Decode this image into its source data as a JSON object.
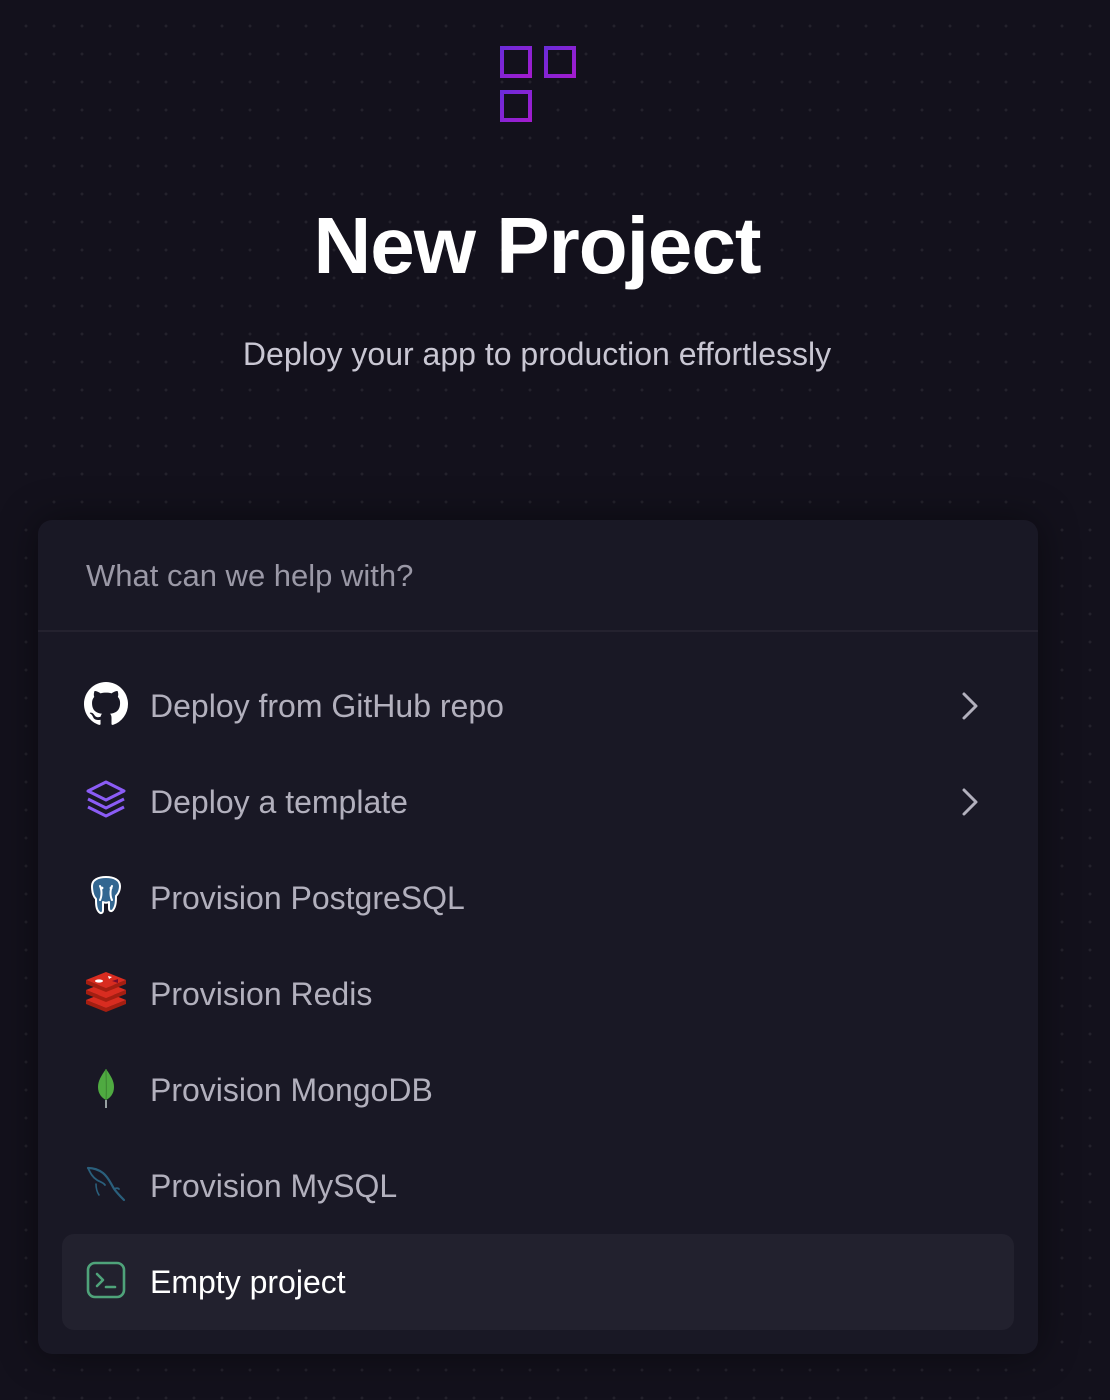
{
  "header": {
    "title": "New Project",
    "subtitle": "Deploy your app to production effortlessly",
    "logo_color": "#8b2fd6"
  },
  "search": {
    "placeholder": "What can we help with?",
    "value": ""
  },
  "menu": {
    "items": [
      {
        "label": "Deploy from GitHub repo",
        "icon": "github-icon",
        "has_chevron": true
      },
      {
        "label": "Deploy a template",
        "icon": "layers-icon",
        "has_chevron": true
      },
      {
        "label": "Provision PostgreSQL",
        "icon": "postgresql-icon",
        "has_chevron": false
      },
      {
        "label": "Provision Redis",
        "icon": "redis-icon",
        "has_chevron": false
      },
      {
        "label": "Provision MongoDB",
        "icon": "mongodb-icon",
        "has_chevron": false
      },
      {
        "label": "Provision MySQL",
        "icon": "mysql-icon",
        "has_chevron": false
      },
      {
        "label": "Empty project",
        "icon": "terminal-icon",
        "has_chevron": false,
        "selected": true
      }
    ]
  },
  "colors": {
    "background": "#13111c",
    "panel": "#191825",
    "selected_row": "#22212e",
    "template_icon": "#8b5cf6",
    "redis_icon": "#c6302b",
    "mongodb_icon": "#4faa41",
    "mysql_icon": "#2a5f7c",
    "terminal_icon": "#4fa37a"
  }
}
